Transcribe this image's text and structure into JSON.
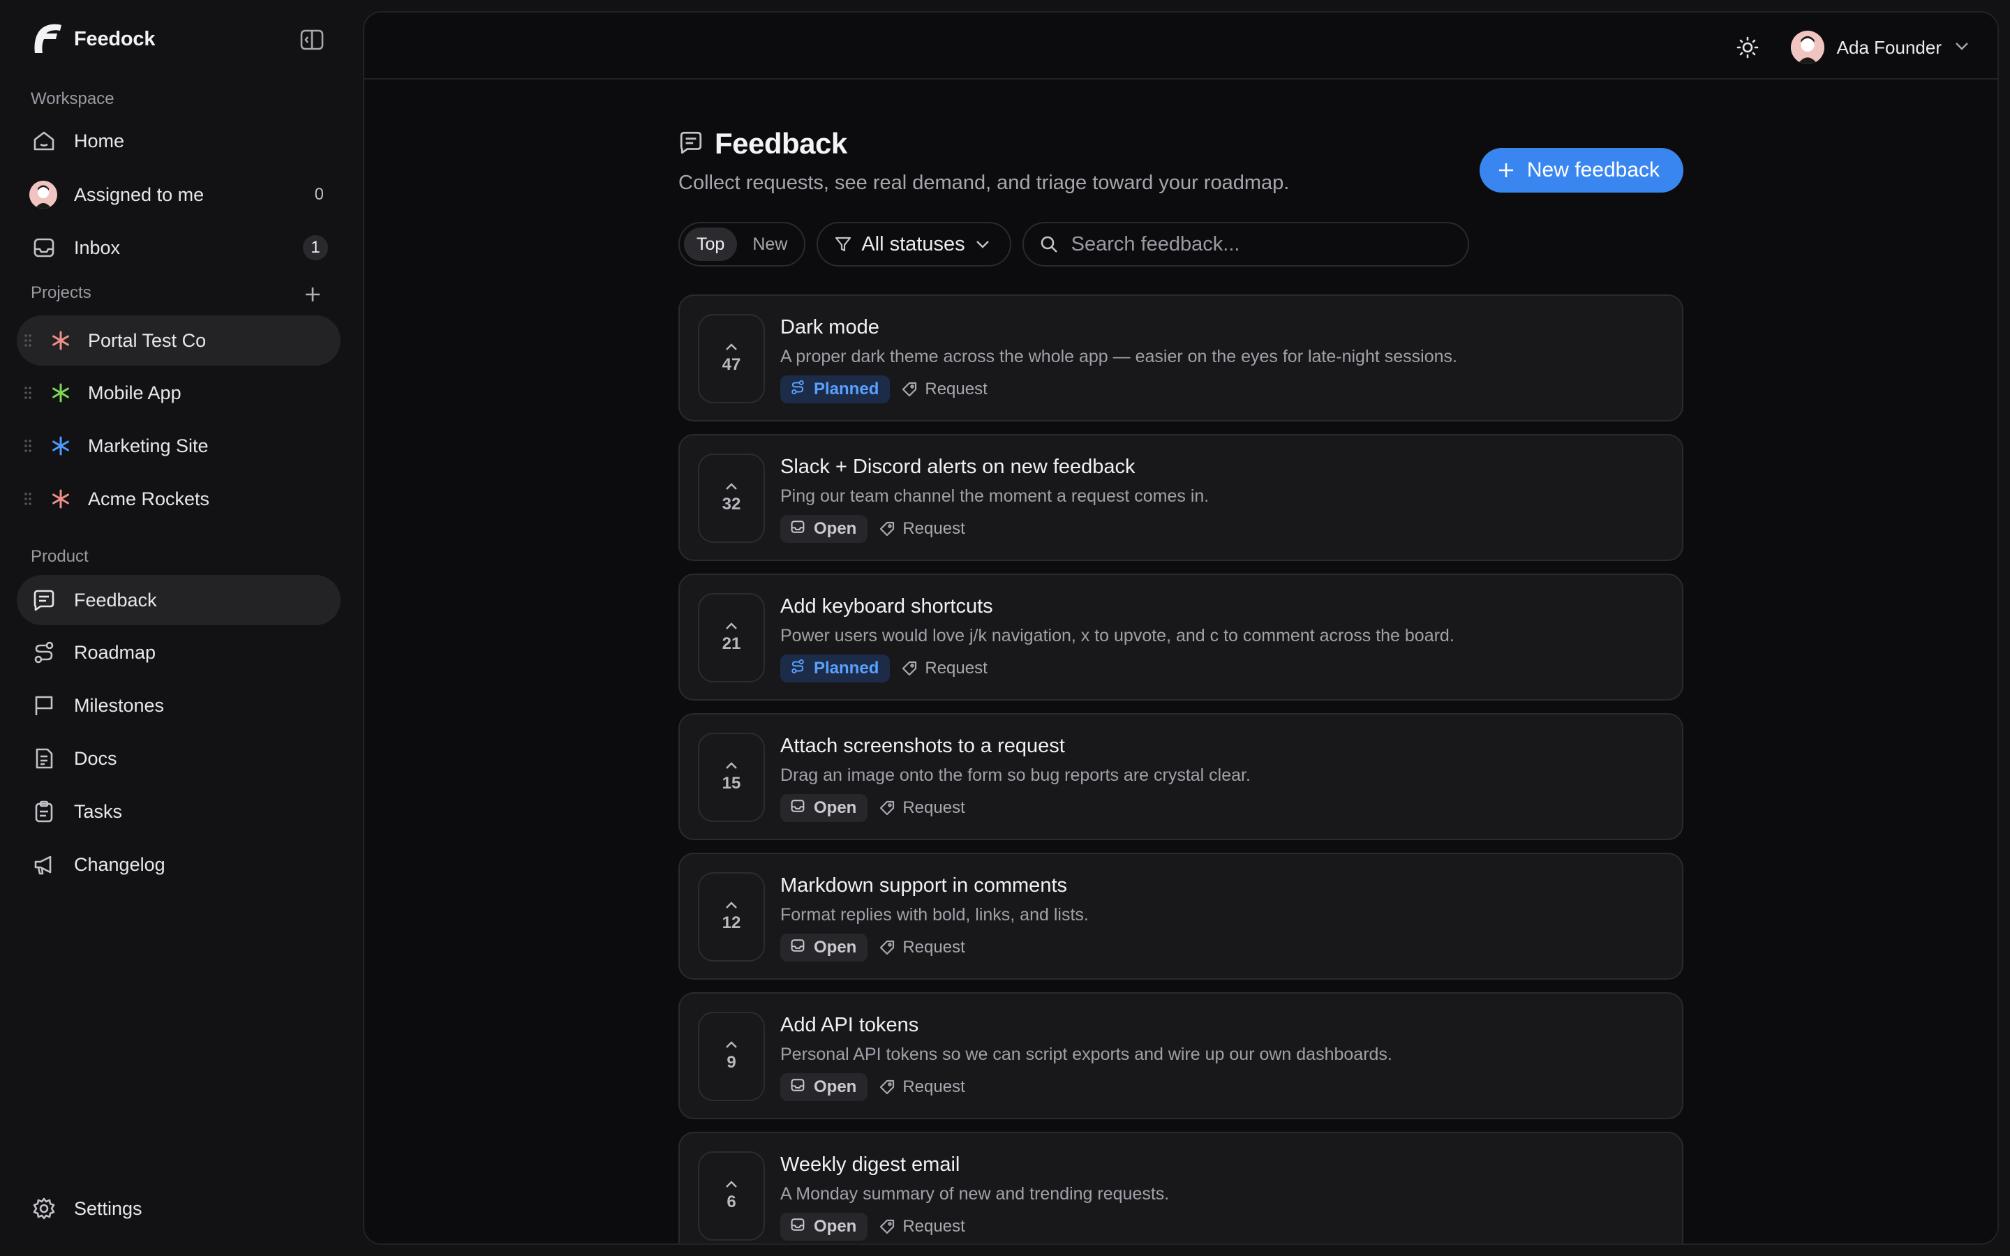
{
  "brand": {
    "name": "Feedock"
  },
  "sidebar": {
    "workspace_label": "Workspace",
    "workspace_items": [
      {
        "label": "Home",
        "icon": "home-icon"
      },
      {
        "label": "Assigned to me",
        "icon": "avatar",
        "count": "0"
      },
      {
        "label": "Inbox",
        "icon": "inbox-icon",
        "count": "1"
      }
    ],
    "projects_label": "Projects",
    "projects": [
      {
        "label": "Portal Test Co",
        "color": "#f0908a"
      },
      {
        "label": "Mobile App",
        "color": "#7ed957"
      },
      {
        "label": "Marketing Site",
        "color": "#4d9bff"
      },
      {
        "label": "Acme Rockets",
        "color": "#f0908a"
      }
    ],
    "product_label": "Product",
    "product_items": [
      {
        "label": "Feedback",
        "icon": "feedback-icon"
      },
      {
        "label": "Roadmap",
        "icon": "roadmap-icon"
      },
      {
        "label": "Milestones",
        "icon": "flag-icon"
      },
      {
        "label": "Docs",
        "icon": "docs-icon"
      },
      {
        "label": "Tasks",
        "icon": "tasks-icon"
      },
      {
        "label": "Changelog",
        "icon": "megaphone-icon"
      }
    ],
    "settings_label": "Settings"
  },
  "topbar": {
    "user_name": "Ada Founder"
  },
  "page": {
    "title": "Feedback",
    "subtitle": "Collect requests, see real demand, and triage toward your roadmap.",
    "new_button_label": "New feedback"
  },
  "filters": {
    "sort_options": [
      "Top",
      "New"
    ],
    "sort_selected": "Top",
    "status_label": "All statuses",
    "search_placeholder": "Search feedback..."
  },
  "feedback_items": [
    {
      "votes": "47",
      "title": "Dark mode",
      "description": "A proper dark theme across the whole app — easier on the eyes for late-night sessions.",
      "status": "Planned",
      "type": "Request"
    },
    {
      "votes": "32",
      "title": "Slack + Discord alerts on new feedback",
      "description": "Ping our team channel the moment a request comes in.",
      "status": "Open",
      "type": "Request"
    },
    {
      "votes": "21",
      "title": "Add keyboard shortcuts",
      "description": "Power users would love j/k navigation, x to upvote, and c to comment across the board.",
      "status": "Planned",
      "type": "Request"
    },
    {
      "votes": "15",
      "title": "Attach screenshots to a request",
      "description": "Drag an image onto the form so bug reports are crystal clear.",
      "status": "Open",
      "type": "Request"
    },
    {
      "votes": "12",
      "title": "Markdown support in comments",
      "description": "Format replies with bold, links, and lists.",
      "status": "Open",
      "type": "Request"
    },
    {
      "votes": "9",
      "title": "Add API tokens",
      "description": "Personal API tokens so we can script exports and wire up our own dashboards.",
      "status": "Open",
      "type": "Request"
    },
    {
      "votes": "6",
      "title": "Weekly digest email",
      "description": "A Monday summary of new and trending requests.",
      "status": "Open",
      "type": "Request"
    }
  ],
  "colors": {
    "accent": "#3a86f0",
    "planned": "#5aa0ff",
    "background": "#0c0c0e"
  }
}
